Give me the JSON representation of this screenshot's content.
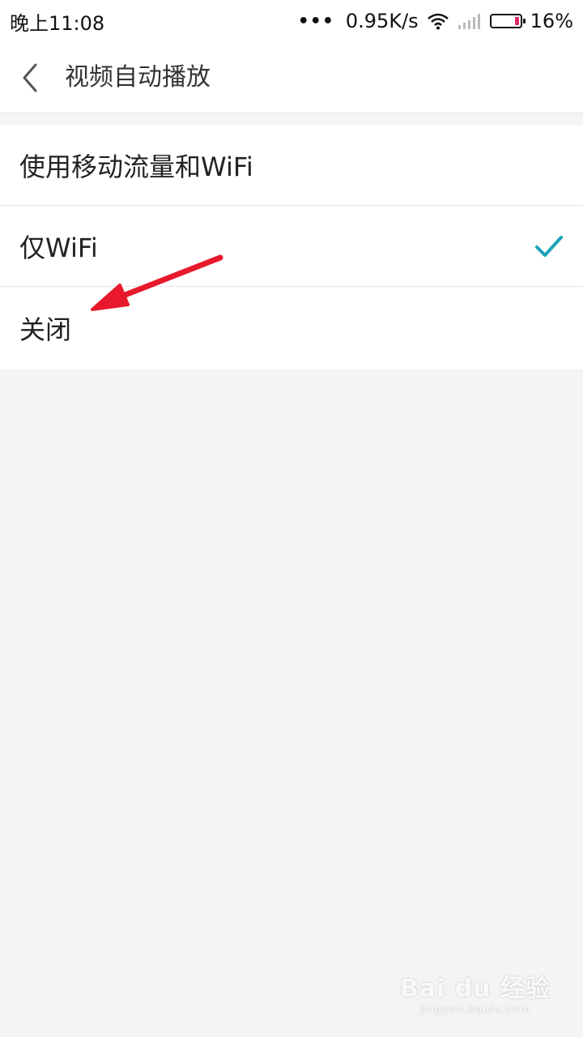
{
  "status_bar": {
    "time": "晚上11:08",
    "dots": "•••",
    "net_speed": "0.95K/s",
    "battery_percent": "16%",
    "battery_level": 0.16
  },
  "header": {
    "title": "视频自动播放"
  },
  "options": [
    {
      "label": "使用移动流量和WiFi",
      "selected": false
    },
    {
      "label": "仅WiFi",
      "selected": true
    },
    {
      "label": "关闭",
      "selected": false
    }
  ],
  "colors": {
    "accent": "#1aa4b8",
    "annotation": "#e8192c",
    "background": "#f4f4f4"
  },
  "watermark": {
    "logo": "Bai du 经验",
    "url": "jingyan.baidu.com"
  }
}
